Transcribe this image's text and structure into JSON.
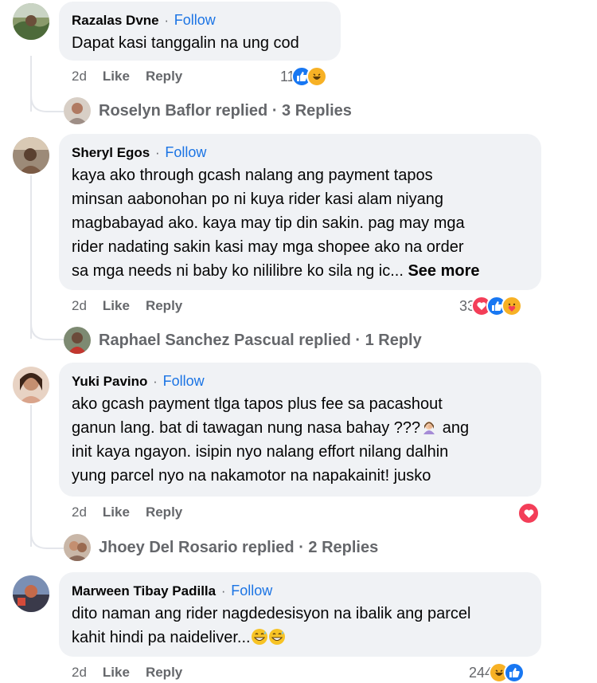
{
  "comments": [
    {
      "author": "Razalas Dvne",
      "separator": "·",
      "follow": "Follow",
      "text": "Dapat kasi tanggalin na ung cod",
      "time": "2d",
      "like": "Like",
      "reply": "Reply",
      "reaction_count": "11",
      "reactions": [
        "like",
        "haha"
      ],
      "replied": "Roselyn Baflor replied · 3 Replies"
    },
    {
      "author": "Sheryl Egos",
      "separator": "·",
      "follow": "Follow",
      "text_lines": [
        "kaya ako through gcash nalang ang payment tapos",
        "minsan aabonohan po ni kuya rider kasi alam niyang",
        "magbabayad ako. kaya may tip din sakin. pag may mga",
        "rider nadating sakin kasi may mga shopee ako na order",
        "sa mga needs ni baby ko nililibre ko sila ng ic..."
      ],
      "see_more": "See more",
      "time": "2d",
      "like": "Like",
      "reply": "Reply",
      "reaction_count": "33",
      "reactions": [
        "love",
        "like",
        "care"
      ],
      "replied": "Raphael Sanchez Pascual replied · 1 Reply"
    },
    {
      "author": "Yuki Pavino",
      "separator": "·",
      "follow": "Follow",
      "text_lines": [
        "ako gcash payment tlga tapos plus fee sa pacashout",
        "ganun lang. bat di tawagan nung nasa bahay ???",
        "init kaya ngayon. isipin nyo nalang effort nilang dalhin",
        "yung parcel nyo na nakamotor na napakainit! jusko"
      ],
      "line2_after_emoji": "ang",
      "time": "2d",
      "like": "Like",
      "reply": "Reply",
      "reactions": [
        "love"
      ],
      "replied": "Jhoey Del Rosario replied · 2 Replies"
    },
    {
      "author": "Marween Tibay Padilla",
      "separator": "·",
      "follow": "Follow",
      "text_lines": [
        "dito naman ang rider nagdedesisyon na ibalik ang parcel",
        "kahit hindi pa naideliver..."
      ],
      "time": "2d",
      "like": "Like",
      "reply": "Reply",
      "reaction_count": "244",
      "reactions": [
        "haha",
        "like"
      ]
    }
  ],
  "colors": {
    "follow_blue": "#1b74e4",
    "bubble_bg": "#f0f2f5",
    "meta_gray": "#65676b",
    "like_blue": "#1877f2",
    "love_red": "#f33e58",
    "haha_yellow": "#f7b125"
  }
}
